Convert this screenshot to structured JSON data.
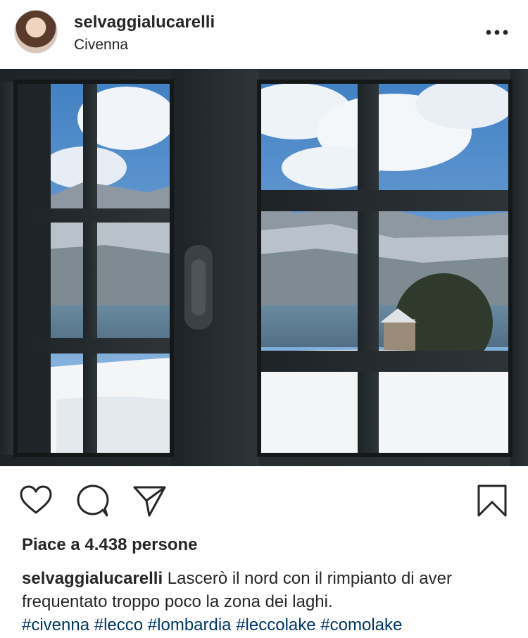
{
  "post": {
    "username": "selvaggialucarelli",
    "location": "Civenna",
    "likes_text": "Piace a 4.438 persone",
    "caption_username": "selvaggialucarelli",
    "caption_text": "Lascerò il nord con il rimpianto di aver frequentato troppo poco la zona dei laghi.",
    "hashtags": [
      "#civenna",
      "#lecco",
      "#lombardia",
      "#leccolake",
      "#comolake"
    ]
  },
  "icons": {
    "more": "more-options-icon",
    "like": "heart-icon",
    "comment": "comment-bubble-icon",
    "share": "paper-plane-icon",
    "save": "bookmark-icon"
  },
  "colors": {
    "text": "#262626",
    "hashtag": "#003569",
    "background": "#ffffff"
  }
}
